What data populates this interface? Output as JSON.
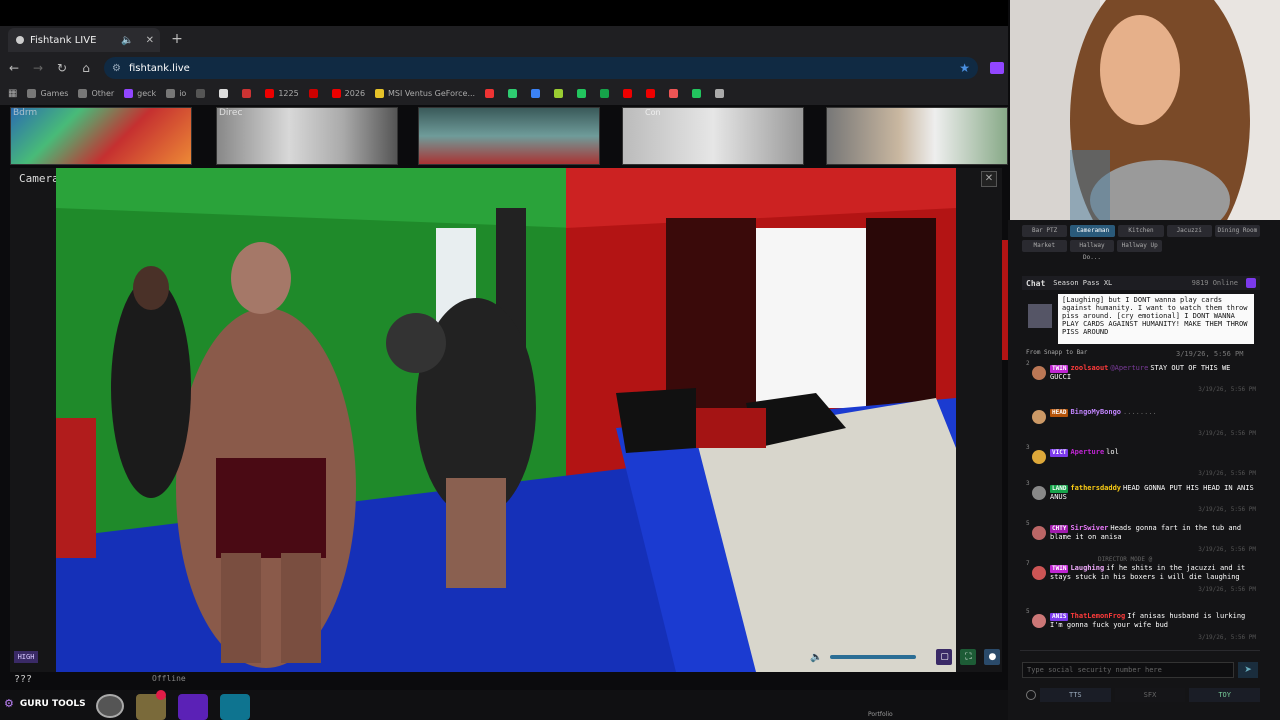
{
  "browser": {
    "tab_title": "Fishtank LIVE",
    "url": "fishtank.live",
    "bookmarks": [
      {
        "label": "Games",
        "color": "#777"
      },
      {
        "label": "Other",
        "color": "#777"
      },
      {
        "label": "geck",
        "color": "#9146ff"
      },
      {
        "label": "io",
        "color": "#777"
      },
      {
        "label": "",
        "color": "#555"
      },
      {
        "label": "",
        "color": "#ddd"
      },
      {
        "label": "",
        "color": "#c33"
      },
      {
        "label": "1225",
        "color": "#e00"
      },
      {
        "label": "",
        "color": "#c00"
      },
      {
        "label": "2026",
        "color": "#e00"
      },
      {
        "label": "MSI Ventus GeForce...",
        "color": "#e6c229"
      },
      {
        "label": "",
        "color": "#e33"
      },
      {
        "label": "",
        "color": "#2ecc71"
      },
      {
        "label": "",
        "color": "#3b82f6"
      },
      {
        "label": "",
        "color": "#9acd32"
      },
      {
        "label": "",
        "color": "#22c55e"
      },
      {
        "label": "",
        "color": "#16a34a"
      },
      {
        "label": "",
        "color": "#e00"
      },
      {
        "label": "",
        "color": "#e00"
      },
      {
        "label": "",
        "color": "#e55"
      },
      {
        "label": "",
        "color": "#22c55e"
      },
      {
        "label": "",
        "color": "#aaa"
      }
    ]
  },
  "thumbnails": [
    {
      "name": "bedroom",
      "label": "Bdrm"
    },
    {
      "name": "director",
      "label": "Direc"
    },
    {
      "name": "jacuzzi",
      "label": ""
    },
    {
      "name": "con",
      "label": "Con"
    },
    {
      "name": "hallway",
      "label": ""
    }
  ],
  "player": {
    "title": "Cameraman",
    "quality": "HIGH",
    "volume": 1.0
  },
  "bottom": {
    "question": "???",
    "offline": "Offline",
    "guru_label": "GURU TOOLS",
    "portfolio": "Portfolio"
  },
  "cam_tabs": [
    [
      "Bar PTZ",
      "Cameraman",
      "Kitchen",
      "Jacuzzi",
      "Dining Room"
    ],
    [
      "Market",
      "Hallway Do...",
      "Hallway Up"
    ]
  ],
  "chat": {
    "title": "Chat",
    "season": "Season Pass XL",
    "online": "9819 Online",
    "quote": "[Laughing] but I DONT wanna play cards against humanity. I want to watch them throw piss around. [cry emotional] I DONT WANNA PLAY CARDS AGAINST HUMANITY! MAKE THEM THROW PISS AROUND",
    "quote_from": "From Snapp to Bar",
    "quote_time": "3/19/26, 5:56 PM",
    "messages": [
      {
        "n": "2",
        "badge": "TWIN",
        "badge_color": "#c026d3",
        "user": "zoolsaout",
        "user_color": "#ff3b3b",
        "mention": "@Aperture",
        "text": "STAY OUT OF THIS WE GUCCI",
        "ts": "3/19/26, 5:56 PM",
        "av": "#b75"
      },
      {
        "n": "",
        "badge": "HEAD",
        "badge_color": "#b45309",
        "user": "BingoMyBongo",
        "user_color": "#c084fc",
        "mention": "",
        "text": "........",
        "ts": "3/19/26, 5:56 PM",
        "av": "#c96"
      },
      {
        "n": "3",
        "badge": "VICT",
        "badge_color": "#7c3aed",
        "user": "Aperture",
        "user_color": "#c026d3",
        "mention": "",
        "text": "lol",
        "ts": "3/19/26, 5:56 PM",
        "av": "#dda83a"
      },
      {
        "n": "3",
        "badge": "LAND",
        "badge_color": "#16a34a",
        "user": "fathersdaddy",
        "user_color": "#facc15",
        "mention": "",
        "text": "HEAD GONNA PUT HIS HEAD IN ANIS ANUS",
        "ts": "3/19/26, 5:56 PM",
        "av": "#888"
      },
      {
        "n": "5",
        "badge": "CHTY",
        "badge_color": "#a21caf",
        "user": "SirSwiver",
        "user_color": "#e879f9",
        "mention": "",
        "text": "Heads gonna fart in the tub and blame it on anisa",
        "ts": "3/19/26, 5:56 PM",
        "av": "#b66"
      },
      {
        "n": "7",
        "badge": "TWIN",
        "badge_color": "#c026d3",
        "user": "Laughing",
        "user_color": "#f0abfc",
        "mention": "",
        "text": "if he shits in the jacuzzi and it stays stuck in his boxers i will die laughing",
        "ts": "3/19/26, 5:56 PM",
        "av": "#c55"
      },
      {
        "n": "5",
        "badge": "ANIS",
        "badge_color": "#7c3aed",
        "user": "ThatLemonFrog",
        "user_color": "#ff3b3b",
        "mention": "",
        "text": "If anisas husband is lurking I'm gonna fuck your wife bud",
        "ts": "3/19/26, 5:56 PM",
        "av": "#c77"
      }
    ],
    "director_mode": "DIRECTOR MODE @",
    "input_placeholder": "Type social security number here",
    "buttons": [
      "TTS",
      "SFX",
      "TOY"
    ]
  }
}
